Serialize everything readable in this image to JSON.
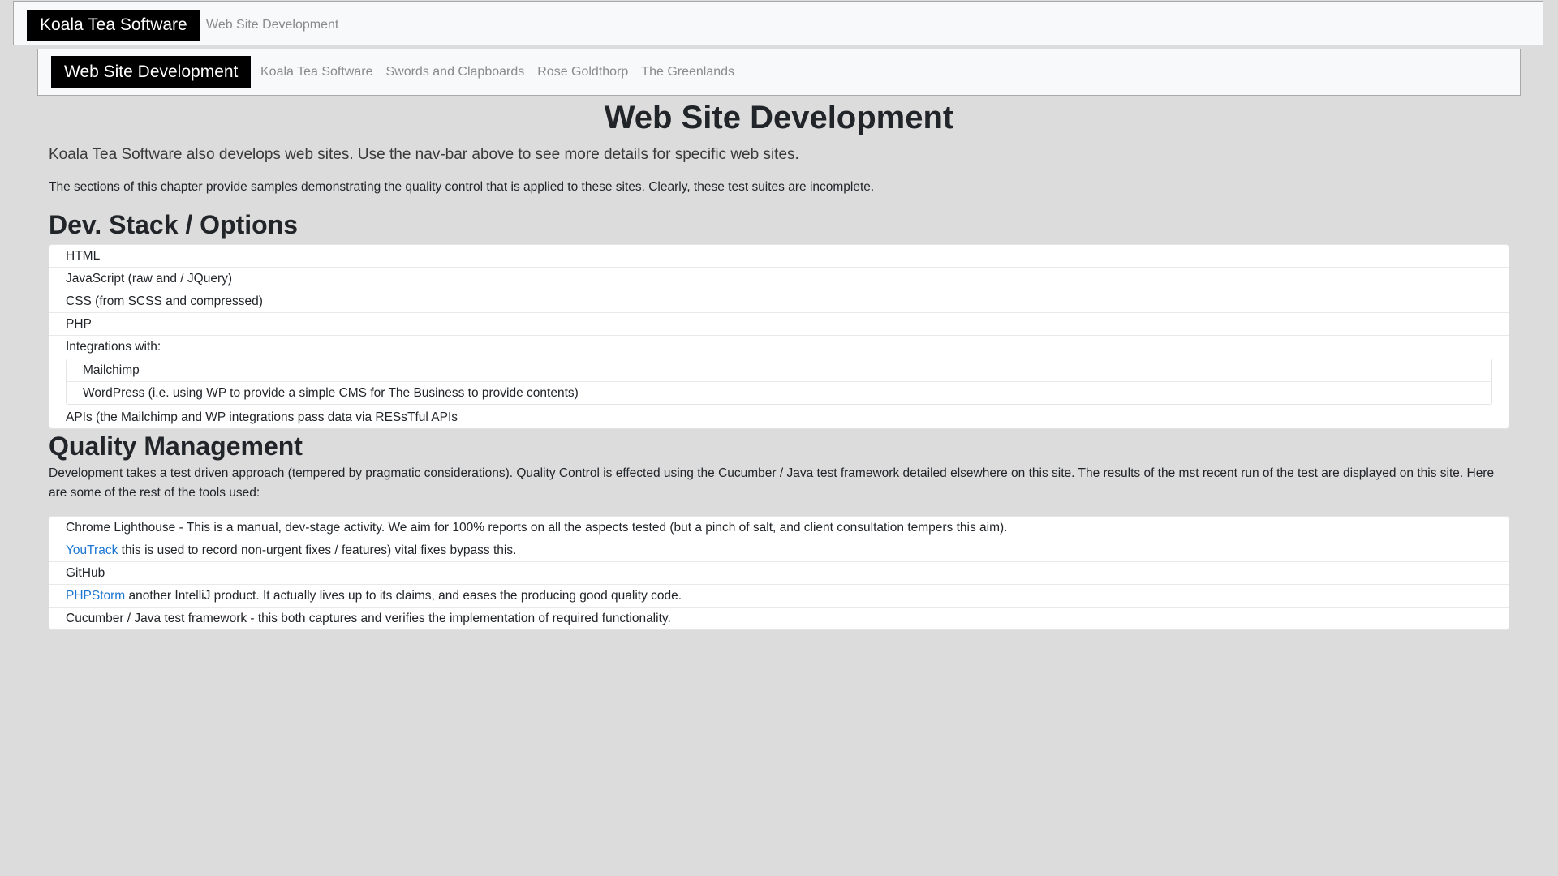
{
  "nav_top": {
    "brand": "Koala Tea Software",
    "links": [
      "Web Site Development"
    ]
  },
  "nav_sub": {
    "brand": "Web Site Development",
    "links": [
      "Koala Tea Software",
      "Swords and Clapboards",
      "Rose Goldthorp",
      "The Greenlands"
    ]
  },
  "page": {
    "title": "Web Site Development",
    "lead": "Koala Tea Software also develops web sites. Use the nav-bar above to see more details for specific web sites.",
    "intro": "The sections of this chapter provide samples demonstrating the quality control that is applied to these sites. Clearly, these test suites are incomplete."
  },
  "dev_stack": {
    "heading": "Dev. Stack / Options",
    "items": [
      "HTML",
      "JavaScript (raw and / JQuery)",
      "CSS (from SCSS and compressed)",
      "PHP"
    ],
    "integrations_label": "Integrations with:",
    "integrations": [
      "Mailchimp",
      "WordPress (i.e. using WP to provide a simple CMS for The Business to provide contents)"
    ],
    "apis": "APIs (the Mailchimp and WP integrations pass data via RESsTful APIs"
  },
  "quality": {
    "heading": "Quality Management",
    "text": "Development takes a test driven approach (tempered by pragmatic considerations). Quality Control is effected using the Cucumber / Java test framework detailed elsewhere on this site. The results of the mst recent run of the test are displayed on this site. Here are some of the rest of the tools used:",
    "tools": {
      "lighthouse": "Chrome Lighthouse - This is a manual, dev-stage activity. We aim for 100% reports on all the aspects tested (but a pinch of salt, and client consultation tempers this aim).",
      "youtrack_link": "YouTrack",
      "youtrack_text": " this is used to record non-urgent fixes / features) vital fixes bypass this.",
      "github": "GitHub",
      "phpstorm_link": "PHPStorm",
      "phpstorm_text": " another IntelliJ product. It actually lives up to its claims, and eases the producing good quality code.",
      "cucumber": "Cucumber / Java test framework - this both captures and verifies the implementation of required functionality."
    }
  },
  "colors": {
    "page_bg": "#dcdcdc",
    "brand_bg": "#000000",
    "link": "#1a76d2"
  }
}
